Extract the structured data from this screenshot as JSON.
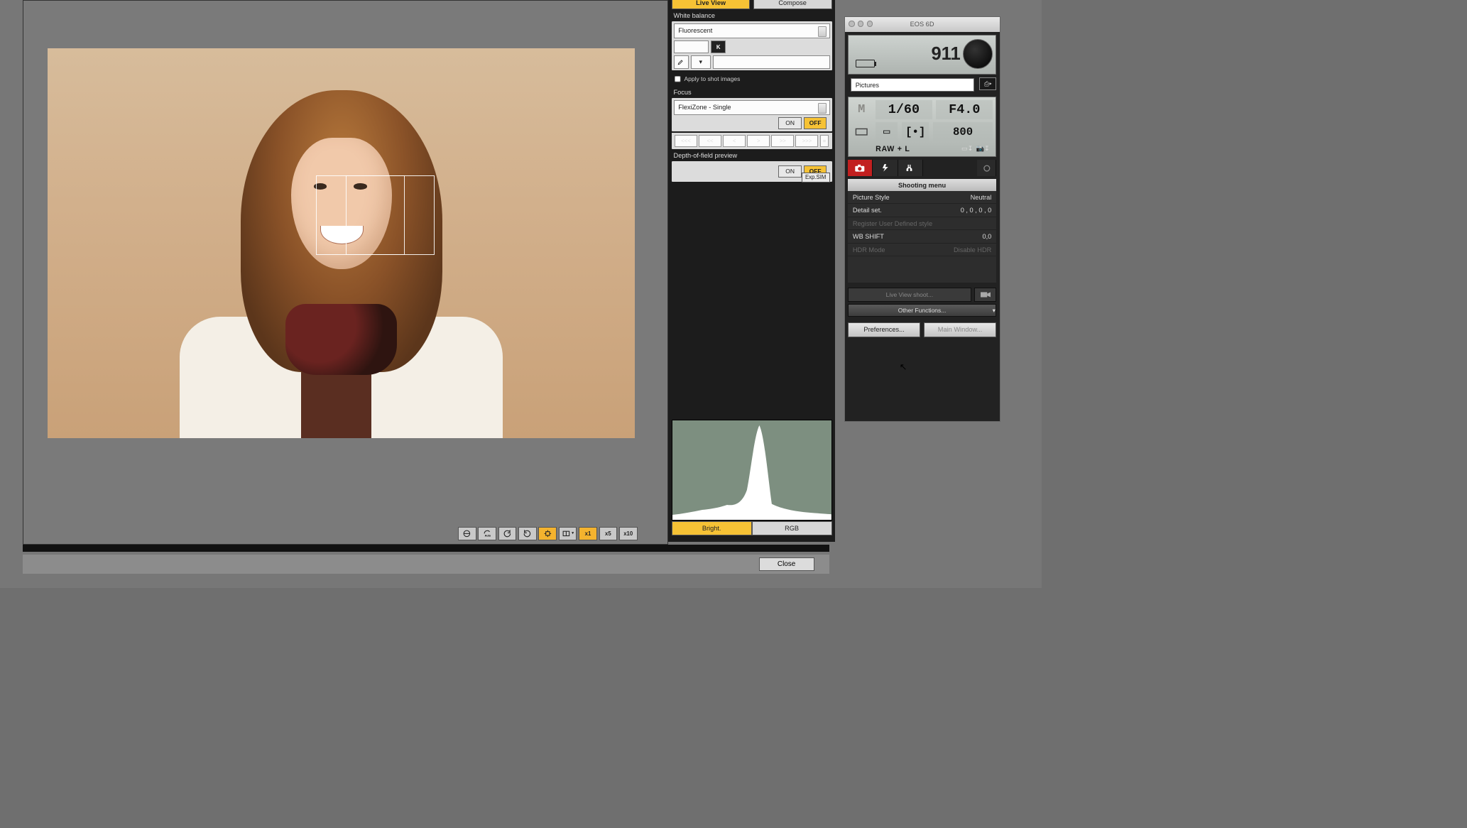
{
  "tabs": {
    "live_view": "Live View",
    "compose": "Compose"
  },
  "wb": {
    "title": "White balance",
    "preset": "Fluorescent",
    "k_label": "K",
    "apply_label": "Apply to shot images"
  },
  "focus": {
    "title": "Focus",
    "mode": "FlexiZone - Single",
    "on": "ON",
    "off": "OFF",
    "nav": [
      "<<<",
      "<<",
      "<",
      ">",
      ">>",
      ">>>"
    ]
  },
  "dof": {
    "title": "Depth-of-field preview",
    "on": "ON",
    "off": "OFF",
    "exp": "Exp.SIM"
  },
  "hist": {
    "bright": "Bright.",
    "rgb": "RGB"
  },
  "close": "Close",
  "camera": {
    "model": "EOS 6D",
    "shots": "911",
    "folder": "Pictures",
    "mode": "M",
    "shutter": "1/60",
    "aperture": "F4.0",
    "iso": "800",
    "quality": "RAW + L"
  },
  "menu": {
    "header": "Shooting menu",
    "rows": [
      {
        "k": "Picture Style",
        "v": "Neutral"
      },
      {
        "k": "Detail set.",
        "v": "0 , 0 , 0 , 0"
      },
      {
        "k": "Register User Defined style",
        "v": "",
        "dim": true
      },
      {
        "k": "WB SHIFT",
        "v": "0,0"
      },
      {
        "k": "HDR Mode",
        "v": "Disable HDR",
        "dim": true
      }
    ]
  },
  "buttons": {
    "live_shoot": "Live View shoot...",
    "other": "Other Functions...",
    "prefs": "Preferences...",
    "main": "Main Window..."
  },
  "toolbar_zoom": {
    "x1": "x1",
    "x5": "x5",
    "x10": "x10"
  }
}
